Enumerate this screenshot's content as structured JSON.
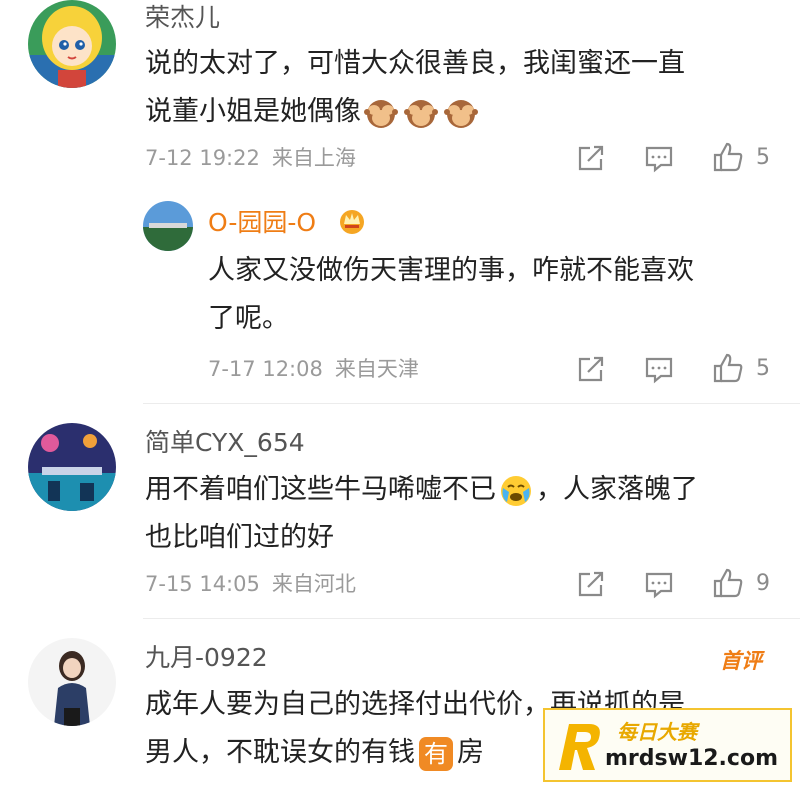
{
  "comments": [
    {
      "user": "荣杰儿",
      "text_lines": [
        "说的太对了，可惜大众很善良，我闺蜜还一直",
        "说董小姐是她偶像"
      ],
      "emoji_after": "see-no-evil-monkey ×3",
      "time": "7-12 19:22",
      "location": "来自上海",
      "likes": "5"
    },
    {
      "user": "O-园园-O",
      "text_lines": [
        "人家又没做伤天害理的事，咋就不能喜欢",
        "了呢。"
      ],
      "time": "7-17 12:08",
      "location": "来自天津",
      "likes": "5"
    },
    {
      "user": "简单CYX_654",
      "text_line1_a": "用不着咱们这些牛马唏嘘不已",
      "text_line1_b": "，人家落魄了",
      "text_line2": "也比咱们过的好",
      "time": "7-15 14:05",
      "location": "来自河北",
      "likes": "9"
    },
    {
      "user": "九月-0922",
      "badge": "首评",
      "text_line1": "成年人要为自己的选择付出代价，再说抓的是",
      "text_line2_a": "男人，不耽误女的有钱",
      "text_line2_badge": "有",
      "text_line2_b": "房"
    }
  ],
  "watermark": {
    "line1": "每日大赛",
    "line2": "mrdsw12.com",
    "logo_letter": "R"
  },
  "colors": {
    "accent": "#ef7d15",
    "text": "#222222",
    "meta": "#9a9a9a"
  }
}
